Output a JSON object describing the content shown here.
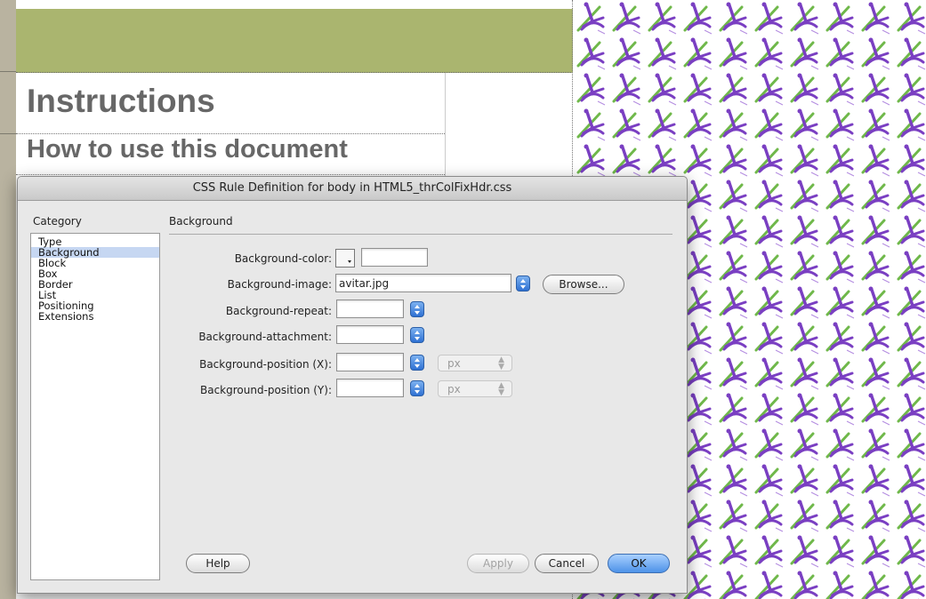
{
  "document": {
    "heading1": "Instructions",
    "heading2": "How to use this document"
  },
  "dialog": {
    "title": "CSS Rule Definition for body in HTML5_thrColFixHdr.css",
    "category_heading": "Category",
    "categories": [
      {
        "label": "Type",
        "selected": false
      },
      {
        "label": "Background",
        "selected": true
      },
      {
        "label": "Block",
        "selected": false
      },
      {
        "label": "Box",
        "selected": false
      },
      {
        "label": "Border",
        "selected": false
      },
      {
        "label": "List",
        "selected": false
      },
      {
        "label": "Positioning",
        "selected": false
      },
      {
        "label": "Extensions",
        "selected": false
      }
    ],
    "section_heading": "Background",
    "fields": {
      "bg_color_label": "Background-color:",
      "bg_color_value": "",
      "bg_image_label": "Background-image:",
      "bg_image_value": "avitar.jpg",
      "browse_label": "Browse...",
      "bg_repeat_label": "Background-repeat:",
      "bg_repeat_value": "",
      "bg_attachment_label": "Background-attachment:",
      "bg_attachment_value": "",
      "bg_pos_x_label": "Background-position (X):",
      "bg_pos_x_value": "",
      "bg_pos_x_unit": "px",
      "bg_pos_y_label": "Background-position (Y):",
      "bg_pos_y_value": "",
      "bg_pos_y_unit": "px"
    },
    "buttons": {
      "help": "Help",
      "apply": "Apply",
      "cancel": "Cancel",
      "ok": "OK"
    }
  },
  "colors": {
    "header_band": "#aab56f",
    "heading_text": "#676767",
    "selection": "#c6d7f2",
    "pattern_purple": "#7a3fc2",
    "pattern_green": "#6fb84a"
  },
  "icons": {
    "stepper": "stepper-icon",
    "color_picker": "color-swatch-icon",
    "pattern": "avatar-tile"
  }
}
